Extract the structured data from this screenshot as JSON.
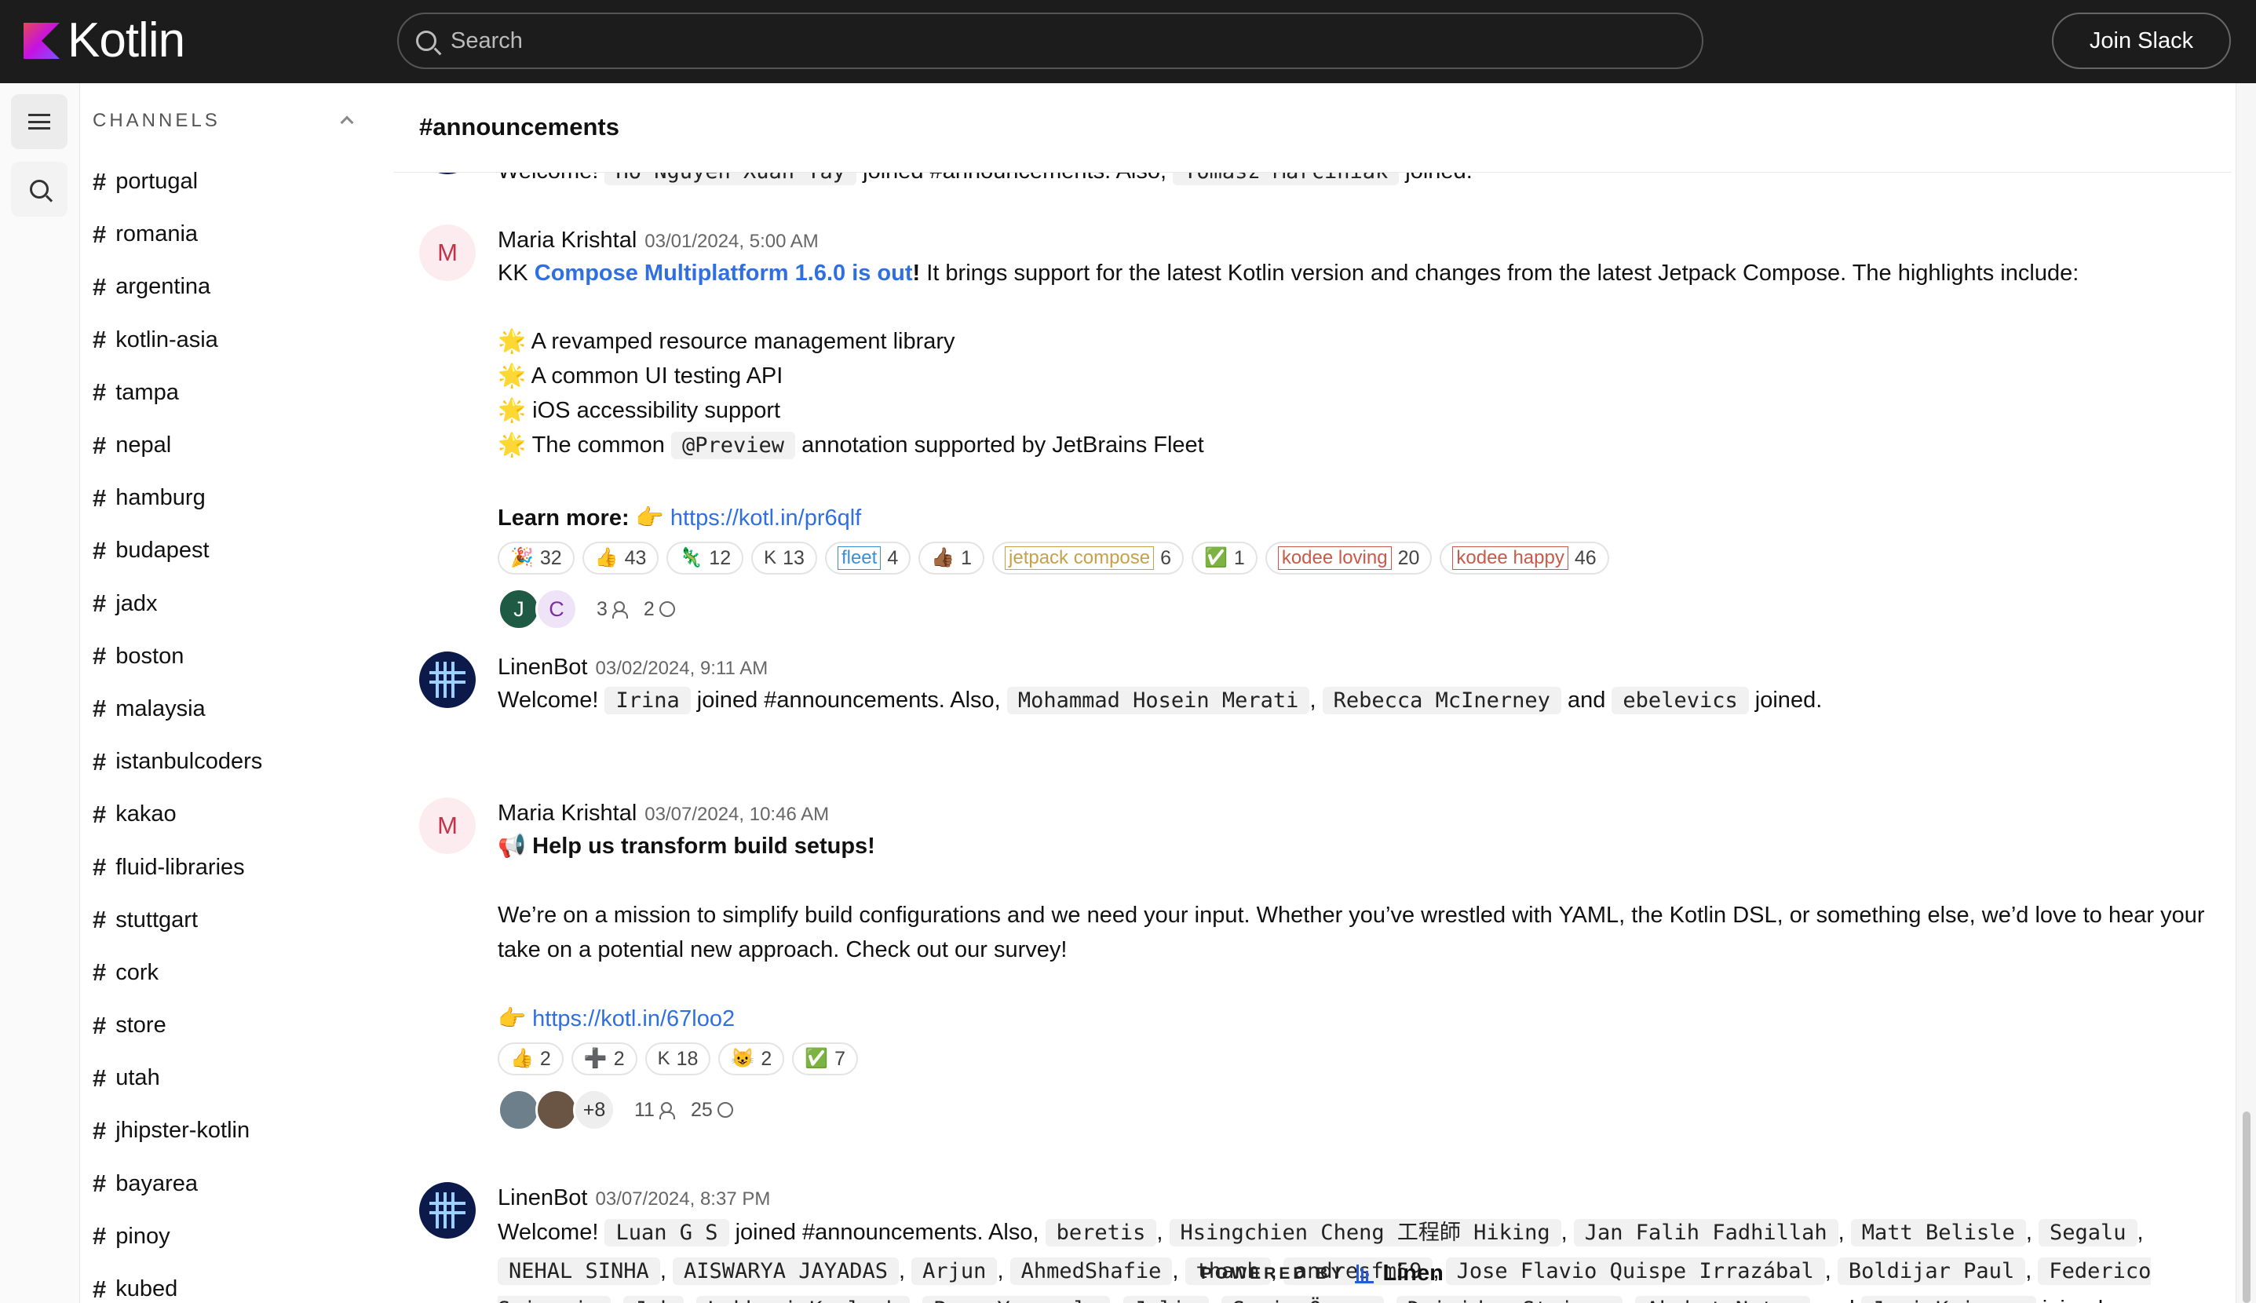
{
  "brand": {
    "name": "Kotlin"
  },
  "search": {
    "placeholder": "Search"
  },
  "header": {
    "join_label": "Join Slack"
  },
  "sidebar": {
    "heading": "CHANNELS",
    "channels": [
      "portugal",
      "romania",
      "argentina",
      "kotlin-asia",
      "tampa",
      "nepal",
      "hamburg",
      "budapest",
      "jadx",
      "boston",
      "malaysia",
      "istanbulcoders",
      "kakao",
      "fluid-libraries",
      "stuttgart",
      "cork",
      "store",
      "utah",
      "jhipster-kotlin",
      "bayarea",
      "pinoy",
      "kubed"
    ]
  },
  "channel": {
    "title": "#announcements"
  },
  "messages": {
    "m0": {
      "welcome": "Welcome!",
      "user1": "Ho Nguyen Xuan Tay",
      "joined": "joined #announcements. Also,",
      "user2": "Tomasz Marciniak",
      "end": "joined."
    },
    "m1": {
      "avatar": "M",
      "author": "Maria Krishtal",
      "time": "03/01/2024, 5:00 AM",
      "prefix": "KK",
      "link_text": "Compose Multiplatform 1.6.0 is out",
      "bang": "!",
      "intro": " It brings support for the latest Kotlin version and changes from the latest Jetpack Compose. The highlights include:",
      "b1": "A revamped resource management library",
      "b2": "A common UI testing API",
      "b3": "iOS accessibility support",
      "b4a": "The common",
      "b4code": "@Preview",
      "b4b": "annotation supported by JetBrains Fleet",
      "learn": "Learn more:",
      "url": "https://kotl.in/pr6qlf",
      "reactions": [
        {
          "emoji": "🎉",
          "count": "32"
        },
        {
          "emoji": "👍",
          "count": "43"
        },
        {
          "emoji": "🦎",
          "count": "12"
        },
        {
          "emoji": "K",
          "count": "13"
        },
        {
          "tag": "fleet",
          "count": "4"
        },
        {
          "emoji": "👍🏾",
          "count": "1"
        },
        {
          "tag": "jetpack compose",
          "count": "6"
        },
        {
          "emoji": "✅",
          "count": "1"
        },
        {
          "tag": "kodee loving",
          "count": "20"
        },
        {
          "tag": "kodee happy",
          "count": "46"
        }
      ],
      "thread": {
        "av1": "J",
        "av2": "C",
        "people": "3",
        "replies": "2"
      }
    },
    "m2": {
      "author": "LinenBot",
      "time": "03/02/2024, 9:11 AM",
      "welcome": "Welcome!",
      "user1": "Irina",
      "joined": "joined #announcements. Also,",
      "user2": "Mohammad Hosein Merati",
      "comma": ",",
      "user3": "Rebecca McInerney",
      "and": "and",
      "user4": "ebelevics",
      "end": "joined."
    },
    "m3": {
      "avatar": "M",
      "author": "Maria Krishtal",
      "time": "03/07/2024, 10:46 AM",
      "headline": "Help us transform build setups!",
      "para": "We’re on a mission to simplify build configurations and we need your input. Whether you’ve wrestled with YAML, the Kotlin DSL, or something else, we’d love to hear your take on a potential new approach. Check out our survey!",
      "url": "https://kotl.in/67loo2",
      "reactions": [
        {
          "emoji": "👍",
          "count": "2"
        },
        {
          "emoji": "➕",
          "count": "2"
        },
        {
          "emoji": "K",
          "count": "18"
        },
        {
          "emoji": "😺",
          "count": "2"
        },
        {
          "emoji": "✅",
          "count": "7"
        }
      ],
      "thread": {
        "more": "+8",
        "people": "11",
        "replies": "25"
      }
    },
    "m4": {
      "author": "LinenBot",
      "time": "03/07/2024, 8:37 PM",
      "welcome": "Welcome!",
      "user1": "Luan G S",
      "joined": "joined #announcements. Also,",
      "users": [
        "beretis",
        "Hsingchien Cheng 工程師 Hiking",
        "Jan Falih Fadhillah",
        "Matt Belisle",
        "Segalu",
        "NEHAL SINHA",
        "AISWARYA JAYADAS",
        "Arjun",
        "AhmedShafie",
        "thanh",
        "andresfm59",
        "Jose Flavio Quispe Irrazábal",
        "Boldijar Paul",
        "Federico Sciascia",
        "Jak",
        "Lakhani Kamlesh",
        "Puru Yanamala",
        "Julie",
        "Şevin Özcan",
        "Deividas Strioga",
        "Akshat Natra"
      ],
      "and": "and",
      "last": "Jari Kuipers",
      "end": "joined."
    }
  },
  "footer": {
    "powered": "POWERED BY",
    "brand": "Linen"
  }
}
